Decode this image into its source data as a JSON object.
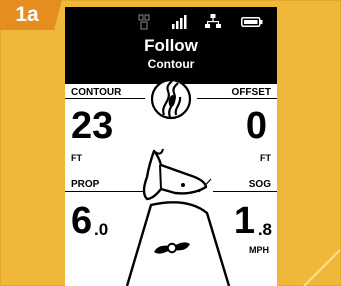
{
  "figure_badge": "1a",
  "status_icons": [
    "motor-icon",
    "signal-bars-icon",
    "network-icon",
    "battery-icon"
  ],
  "header": {
    "mode": "Follow",
    "submode": "Contour"
  },
  "contour": {
    "label": "CONTOUR",
    "value": "23",
    "unit": "FT",
    "icon": "contour-follow-icon"
  },
  "offset": {
    "label": "OFFSET",
    "value": "0",
    "unit": "FT"
  },
  "prop": {
    "label": "PROP",
    "whole": "6",
    "decimal": ".0",
    "icon": "propeller-icon"
  },
  "sog": {
    "label": "SOG",
    "whole": "1",
    "decimal": ".8",
    "unit": "MPH"
  },
  "motor_icon": "trolling-motor-icon"
}
